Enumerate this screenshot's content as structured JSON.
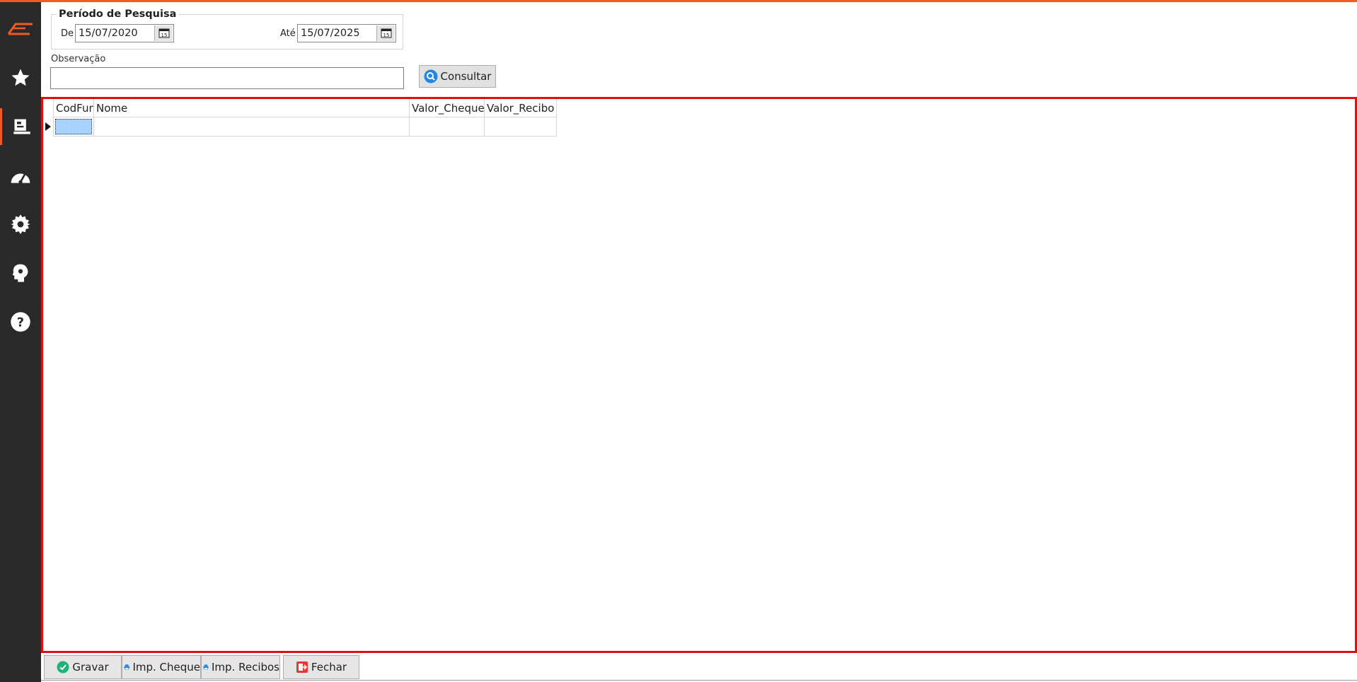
{
  "colors": {
    "accent": "#f05a22",
    "sidebar_bg": "#2a2a2a",
    "grid_border": "#e01010",
    "selected_cell": "#a9d3ff"
  },
  "sidebar": {
    "items": [
      {
        "icon": "logo-icon"
      },
      {
        "icon": "star-icon"
      },
      {
        "icon": "register-icon",
        "active": true
      },
      {
        "icon": "dashboard-gauge-icon"
      },
      {
        "icon": "gear-icon"
      },
      {
        "icon": "head-gear-icon"
      },
      {
        "icon": "help-icon"
      }
    ]
  },
  "period": {
    "title": "Período de Pesquisa",
    "from_label": "De",
    "from_value": "15/07/2020",
    "to_label": "Até",
    "to_value": "15/07/2025"
  },
  "observation": {
    "label": "Observação",
    "value": ""
  },
  "consult_button": {
    "label": "Consultar"
  },
  "grid": {
    "columns": [
      "CodFun",
      "Nome",
      "Valor_Cheque",
      "Valor_Recibo"
    ],
    "rows": [
      [
        "",
        "",
        "",
        ""
      ]
    ]
  },
  "bottom_buttons": {
    "save": "Gravar",
    "print_check": "Imp. Cheque",
    "print_receipt": "Imp. Recibos",
    "close": "Fechar"
  }
}
